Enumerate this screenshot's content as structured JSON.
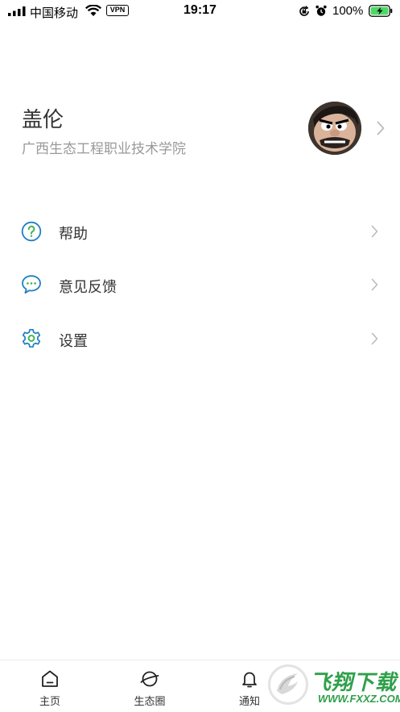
{
  "status_bar": {
    "carrier": "中国移动",
    "vpn": "VPN",
    "time": "19:17",
    "battery_percent": "100%"
  },
  "profile": {
    "name": "盖伦",
    "school": "广西生态工程职业技术学院"
  },
  "menu": [
    {
      "label": "帮助",
      "icon": "help-circle-icon"
    },
    {
      "label": "意见反馈",
      "icon": "feedback-chat-icon"
    },
    {
      "label": "设置",
      "icon": "gear-icon"
    }
  ],
  "tabs": [
    {
      "label": "主页",
      "icon": "home-icon"
    },
    {
      "label": "生态圈",
      "icon": "planet-icon"
    },
    {
      "label": "通知",
      "icon": "bell-icon"
    }
  ],
  "watermark": {
    "title": "飞翔下载",
    "url": "WWW.FXXZ.COM"
  },
  "colors": {
    "accent": "#1f7fc4",
    "text": "#333333",
    "secondary_text": "#999999",
    "chevron": "#bbbbbb",
    "battery": "#4cd964",
    "watermark": "#2fa04a"
  }
}
